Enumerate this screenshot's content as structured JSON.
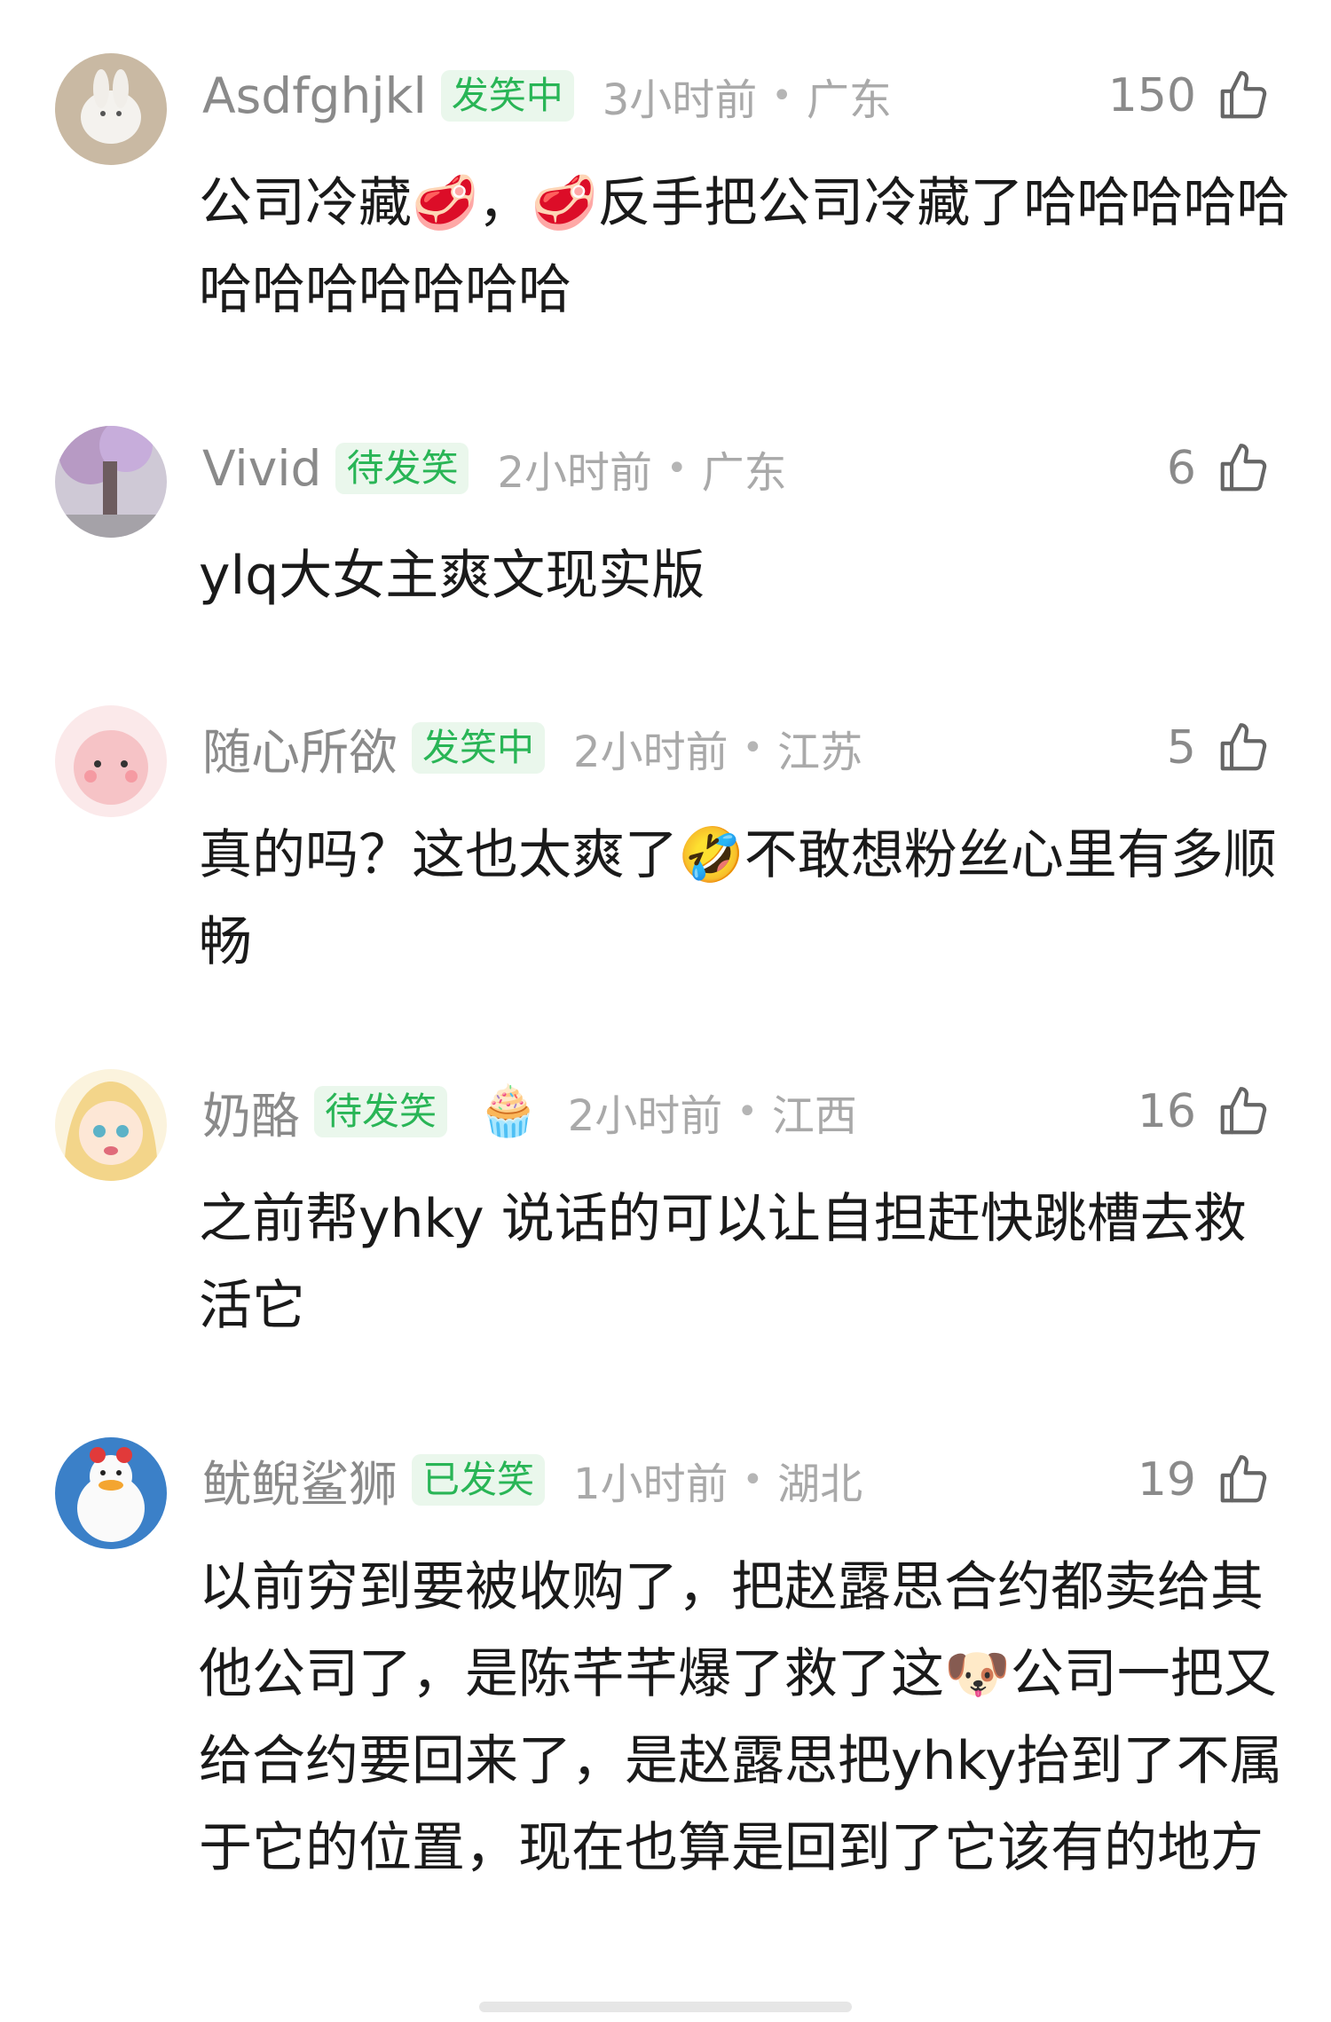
{
  "comments": [
    {
      "username": "Asdfghjkl",
      "badge": "发笑中",
      "time": "3小时前",
      "region": "广东",
      "likes": "150",
      "text": "公司冷藏🥩，🥩反手把公司冷藏了哈哈哈哈哈哈哈哈哈哈哈哈",
      "avatar_icon": "white-rabbit-avatar"
    },
    {
      "username": "Vivid",
      "badge": "待发笑",
      "time": "2小时前",
      "region": "广东",
      "likes": "6",
      "text": "ylq大女主爽文现实版",
      "avatar_icon": "cherry-blossom-tree-avatar"
    },
    {
      "username": "随心所欲",
      "badge": "发笑中",
      "time": "2小时前",
      "region": "江苏",
      "likes": "5",
      "text": "真的吗？这也太爽了🤣不敢想粉丝心里有多顺畅",
      "avatar_icon": "pink-blob-avatar"
    },
    {
      "username": "奶酪",
      "badge": "待发笑",
      "badge_extra_icon": "cupcake-icon",
      "time": "2小时前",
      "region": "江西",
      "likes": "16",
      "text": "之前帮yhky 说话的可以让自担赶快跳槽去救活它",
      "avatar_icon": "anime-girl-avatar"
    },
    {
      "username": "鱿鲵鲨狮",
      "badge": "已发笑",
      "time": "1小时前",
      "region": "湖北",
      "likes": "19",
      "text": "以前穷到要被收购了，把赵露思合约都卖给其他公司了，是陈芊芊爆了救了这🐶公司一把又给合约要回来了，是赵露思把yhky抬到了不属于它的位置，现在也算是回到了它该有的地方",
      "avatar_icon": "duck-avatar"
    }
  ],
  "colors": {
    "badge_text": "#29b556",
    "badge_bg": "#eaf7ec",
    "meta_text": "#8a8a8a",
    "body_text": "#1a1a1a"
  }
}
